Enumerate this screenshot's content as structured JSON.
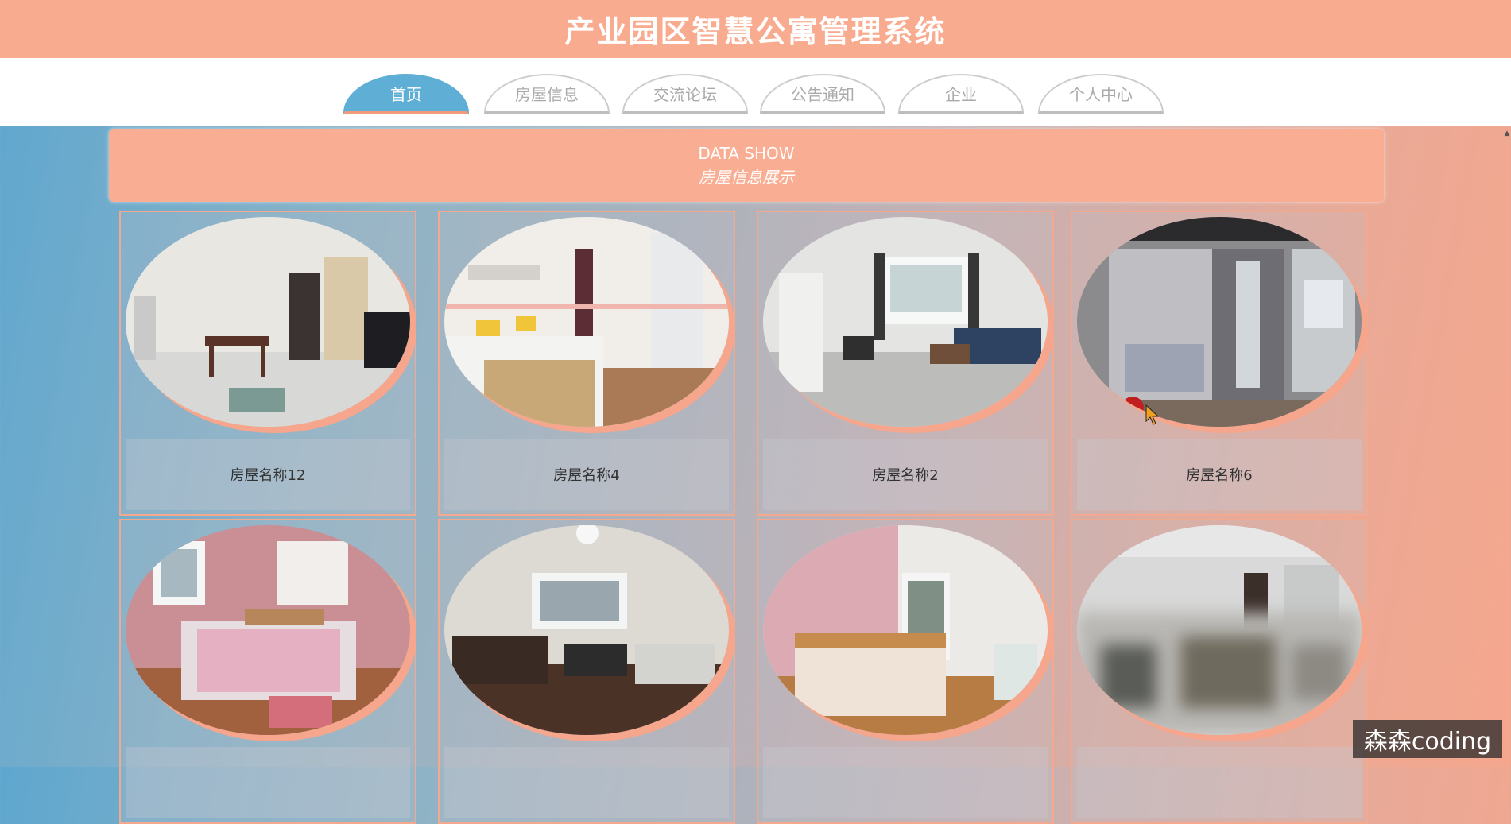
{
  "app": {
    "title": "产业园区智慧公寓管理系统"
  },
  "nav": {
    "tabs": [
      {
        "label": "首页",
        "active": true
      },
      {
        "label": "房屋信息",
        "active": false
      },
      {
        "label": "交流论坛",
        "active": false
      },
      {
        "label": "公告通知",
        "active": false
      },
      {
        "label": "企业",
        "active": false
      },
      {
        "label": "个人中心",
        "active": false
      }
    ]
  },
  "section": {
    "heading_en": "DATA SHOW",
    "heading_cn": "房屋信息展示"
  },
  "houses": [
    {
      "name": "房屋名称12"
    },
    {
      "name": "房屋名称4"
    },
    {
      "name": "房屋名称2"
    },
    {
      "name": "房屋名称6"
    },
    {
      "name": ""
    },
    {
      "name": ""
    },
    {
      "name": ""
    },
    {
      "name": ""
    }
  ],
  "watermark": "森森coding",
  "colors": {
    "header_bg": "#f9ab8f",
    "active_tab": "#5eaed6",
    "banner_bg": "#f9ad92",
    "card_border": "#f4a88e"
  }
}
